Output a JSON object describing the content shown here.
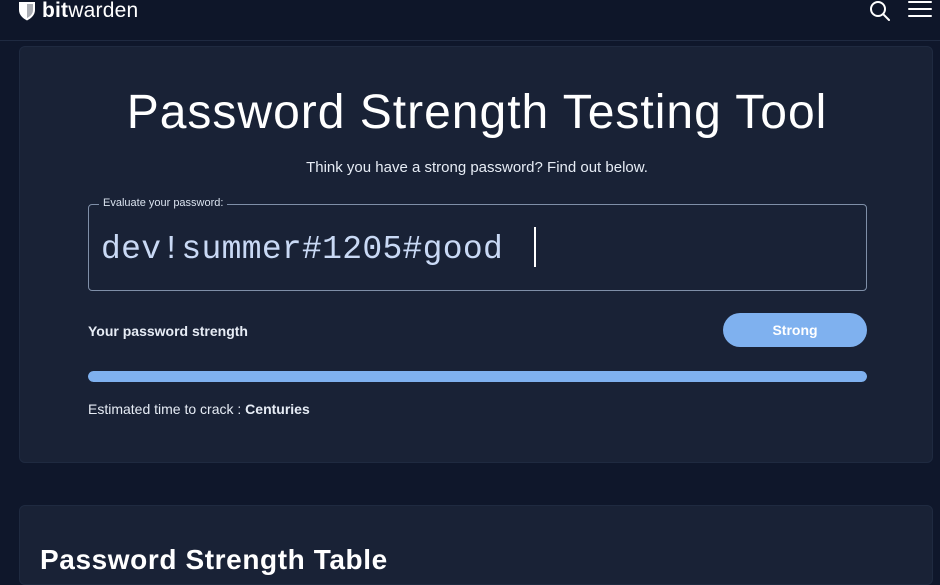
{
  "header": {
    "logo_bold": "bit",
    "logo_light": "warden",
    "search_icon": "search-icon",
    "menu_icon": "hamburger-menu-icon"
  },
  "tool": {
    "title": "Password Strength Testing Tool",
    "subtitle": "Think you have a strong password? Find out below.",
    "field_label": "Evaluate your password:",
    "password_value": "dev!summer#1205#good",
    "strength_label": "Your password strength",
    "strength_value": "Strong",
    "strength_percent": 100,
    "crack_label": "Estimated time to crack :",
    "crack_value": "Centuries"
  },
  "table_section": {
    "title": "Password Strength Table"
  },
  "colors": {
    "background": "#0f172b",
    "card": "#192236",
    "accent": "#7fb1ef",
    "text": "#e6ecf5"
  }
}
